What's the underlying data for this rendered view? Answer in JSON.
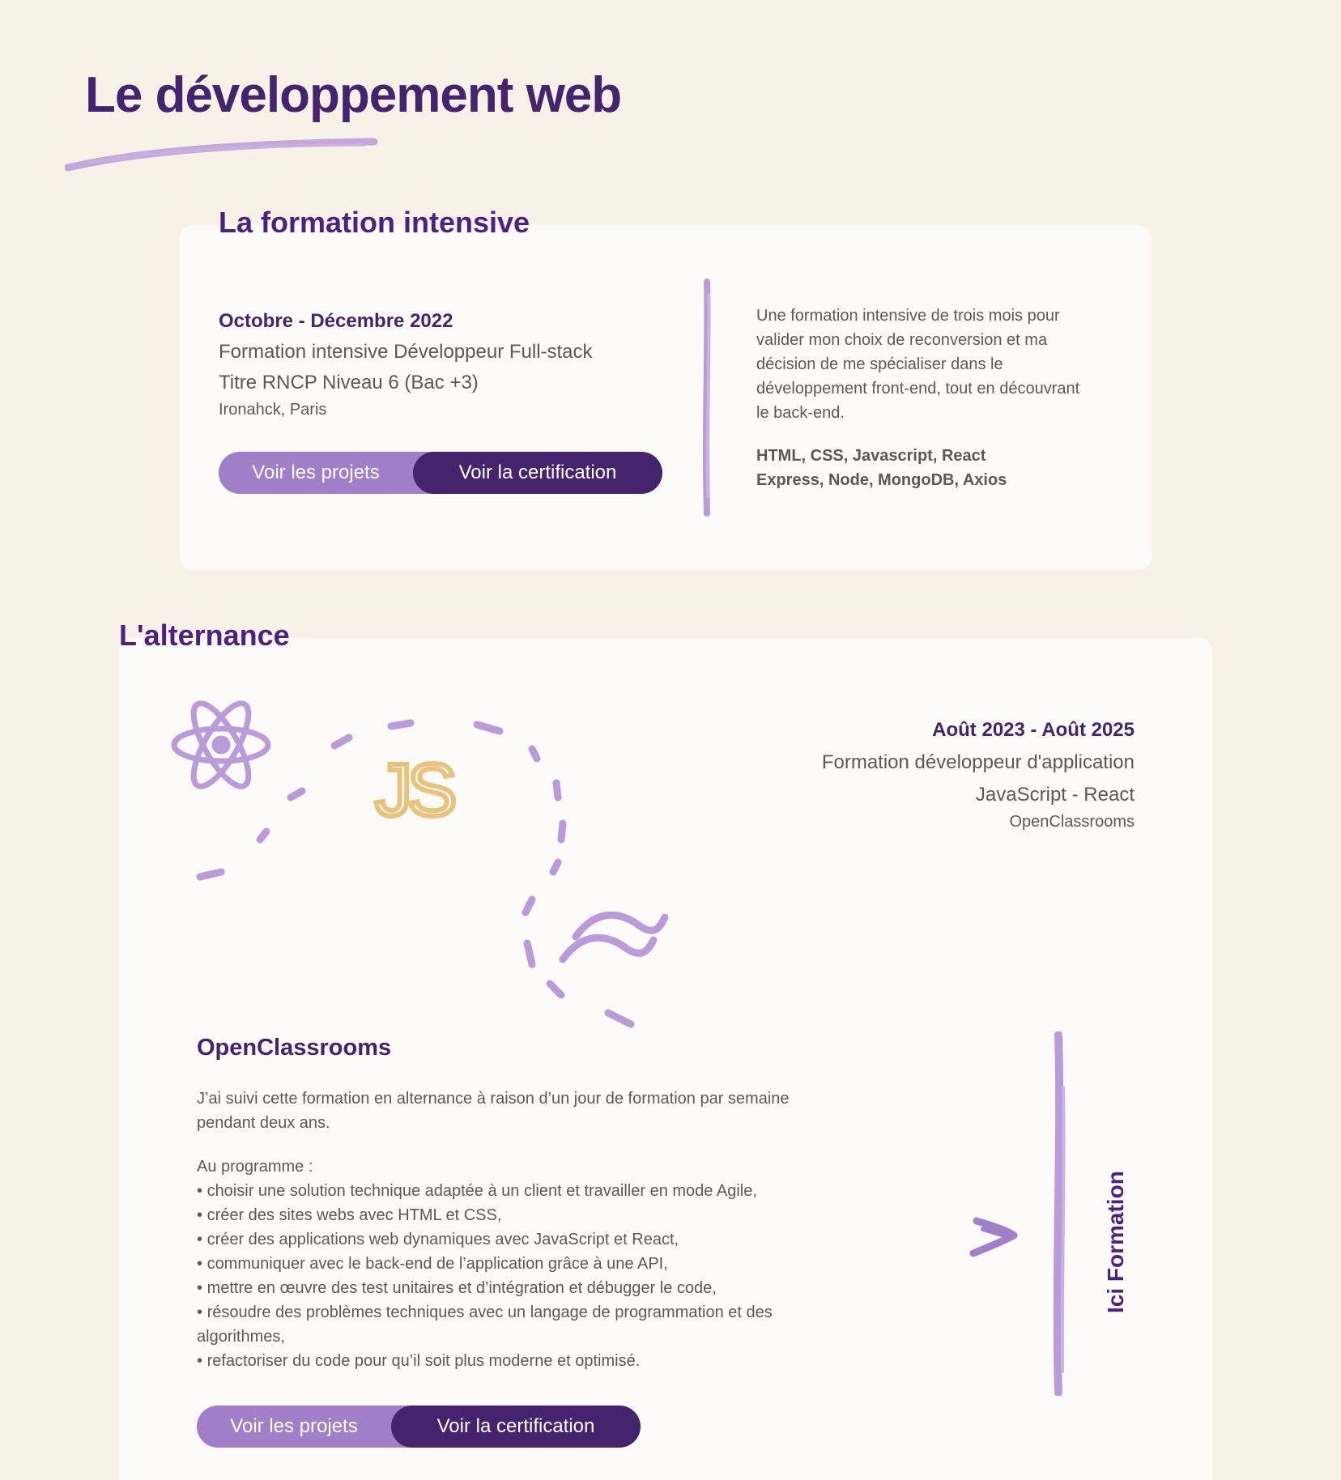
{
  "main": {
    "title": "Le développement web"
  },
  "formation_intensive": {
    "title": "La formation intensive",
    "period": "Octobre - Décembre 2022",
    "diploma_line1": "Formation intensive Développeur Full-stack",
    "diploma_line2": "Titre RNCP Niveau 6 (Bac +3)",
    "school": "Ironahck, Paris",
    "projects_button": "Voir les projets",
    "certification_button": "Voir la certification",
    "description": "Une formation intensive de trois mois pour valider mon choix de reconversion et ma décision de me spécialiser dans le développement front-end, tout en découvrant le back-end.",
    "tech_line1": "HTML, CSS, Javascript, React",
    "tech_line2": "Express, Node, MongoDB, Axios"
  },
  "alternance": {
    "title": "L'alternance",
    "period": "Août 2023 - Août 2025",
    "diploma_line1": "Formation développeur d'application",
    "diploma_line2": "JavaScript - React",
    "school": "OpenClassrooms",
    "js_logo_text": "JS",
    "org_title": "OpenClassrooms",
    "description": "J’ai suivi cette formation en alternance à raison d’un jour de formation par semaine pendant deux ans.",
    "programme_title": "Au programme :",
    "programme_items": [
      "choisir une solution technique adaptée à un client et travailler en mode Agile,",
      "créer des sites webs avec HTML et CSS,",
      "créer des applications web dynamiques avec JavaScript et React,",
      "communiquer avec le back-end de l’application grâce à une API,",
      "mettre en œuvre des test unitaires et d’intégration et débugger le code,",
      "résoudre des problèmes techniques avec un langage de programmation et des algorithmes,",
      "refactoriser du code pour qu’il soit plus moderne et optimisé."
    ],
    "projects_button": "Voir les projets",
    "certification_button": "Voir la certification",
    "side_label": "Ici Formation"
  },
  "icons": {
    "react": "react-icon",
    "javascript": "javascript-icon",
    "tailwind": "tailwind-icon",
    "arrow": "arrow-right-icon"
  },
  "colors": {
    "background": "#f8f1e7",
    "card": "#fdfbf9",
    "primary": "#44246e",
    "accent": "#a07ec8",
    "text": "#5c5854",
    "js_yellow": "#e8c37d"
  }
}
